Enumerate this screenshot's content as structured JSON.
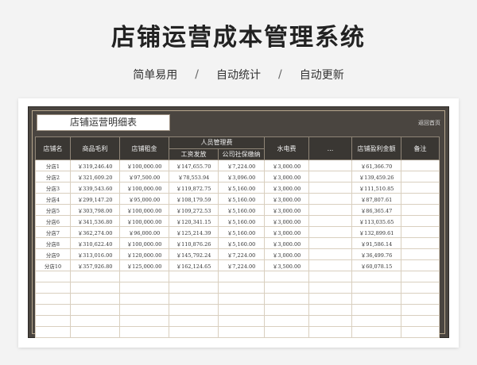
{
  "hero": {
    "title": "店铺运营成本管理系统",
    "tags": [
      "简单易用",
      "自动统计",
      "自动更新"
    ],
    "separator": "/"
  },
  "sheet": {
    "title": "店铺运营明细表",
    "return_home": "返回首页",
    "headers": {
      "store": "店铺名",
      "gross_profit": "商品毛利",
      "rent": "店铺租金",
      "staff_group": "人员管理费",
      "salary": "工资发放",
      "social_security": "公司社保缴纳",
      "utilities": "水电费",
      "more": "...",
      "net_profit": "店铺盈利金额",
      "remark": "备注"
    },
    "rows": [
      {
        "store": "分店1",
        "gross_profit": "￥319,246.40",
        "rent": "￥100,000.00",
        "salary": "￥147,655.70",
        "social": "￥7,224.00",
        "utilities": "￥3,000.00",
        "profit": "￥61,366.70"
      },
      {
        "store": "分店2",
        "gross_profit": "￥321,609.20",
        "rent": "￥97,500.00",
        "salary": "￥78,553.94",
        "social": "￥3,096.00",
        "utilities": "￥3,000.00",
        "profit": "￥139,459.26"
      },
      {
        "store": "分店3",
        "gross_profit": "￥339,543.60",
        "rent": "￥100,000.00",
        "salary": "￥119,872.75",
        "social": "￥5,160.00",
        "utilities": "￥3,000.00",
        "profit": "￥111,510.85"
      },
      {
        "store": "分店4",
        "gross_profit": "￥299,147.20",
        "rent": "￥95,000.00",
        "salary": "￥108,179.59",
        "social": "￥5,160.00",
        "utilities": "￥3,000.00",
        "profit": "￥87,807.61"
      },
      {
        "store": "分店5",
        "gross_profit": "￥303,798.00",
        "rent": "￥100,000.00",
        "salary": "￥109,272.53",
        "social": "￥5,160.00",
        "utilities": "￥3,000.00",
        "profit": "￥86,365.47"
      },
      {
        "store": "分店6",
        "gross_profit": "￥341,536.80",
        "rent": "￥100,000.00",
        "salary": "￥120,341.15",
        "social": "￥5,160.00",
        "utilities": "￥3,000.00",
        "profit": "￥113,035.65"
      },
      {
        "store": "分店7",
        "gross_profit": "￥362,274.00",
        "rent": "￥96,000.00",
        "salary": "￥125,214.39",
        "social": "￥5,160.00",
        "utilities": "￥3,000.00",
        "profit": "￥132,899.61"
      },
      {
        "store": "分店8",
        "gross_profit": "￥310,622.40",
        "rent": "￥100,000.00",
        "salary": "￥110,876.26",
        "social": "￥5,160.00",
        "utilities": "￥3,000.00",
        "profit": "￥91,586.14"
      },
      {
        "store": "分店9",
        "gross_profit": "￥313,016.00",
        "rent": "￥120,000.00",
        "salary": "￥145,792.24",
        "social": "￥7,224.00",
        "utilities": "￥3,000.00",
        "profit": "￥36,499.76"
      },
      {
        "store": "分店10",
        "gross_profit": "￥357,926.80",
        "rent": "￥125,000.00",
        "salary": "￥162,124.65",
        "social": "￥7,224.00",
        "utilities": "￥3,500.00",
        "profit": "￥60,078.15"
      }
    ],
    "empty_rows": 6
  }
}
